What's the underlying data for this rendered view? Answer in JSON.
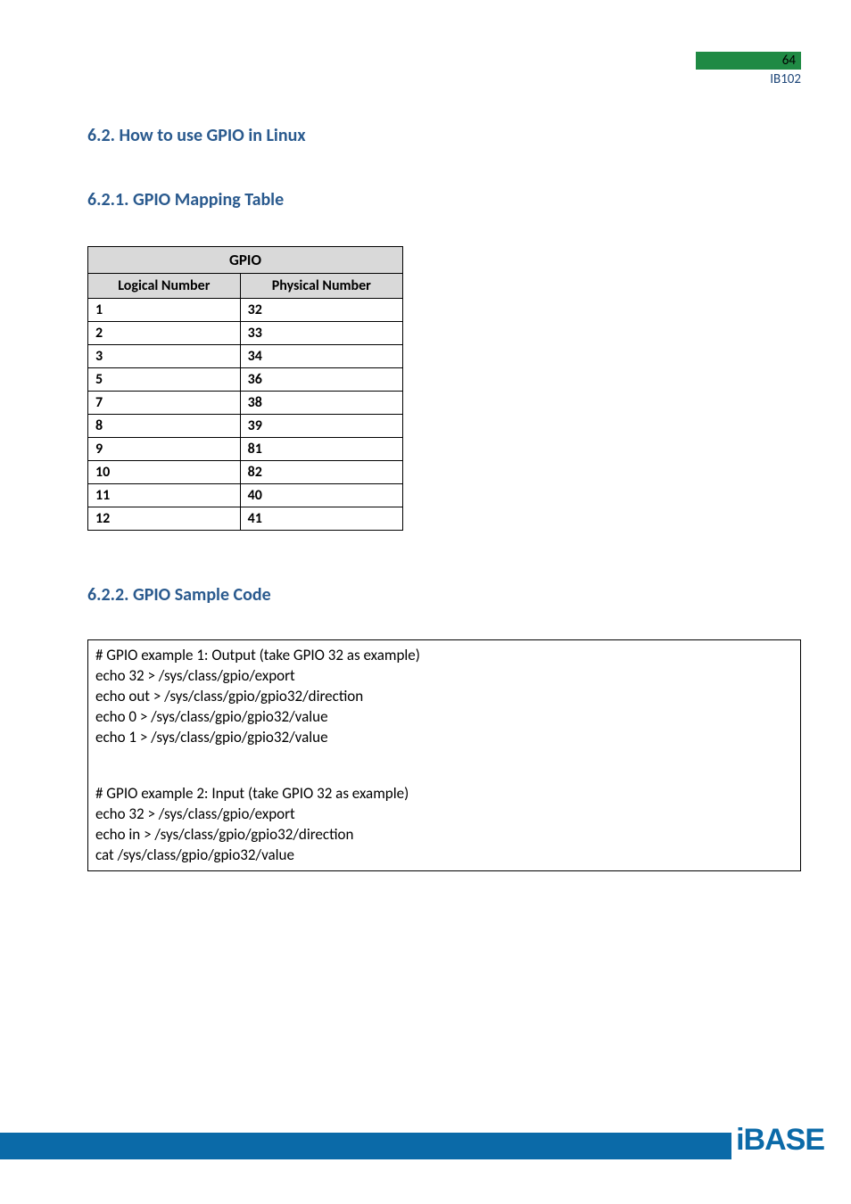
{
  "header": {
    "page_number": "64",
    "doc_id": "IB102"
  },
  "headings": {
    "h62": "6.2.  How to use GPIO in Linux",
    "h621": "6.2.1. GPIO Mapping Table",
    "h622": "6.2.2. GPIO Sample Code"
  },
  "table": {
    "title": "GPIO",
    "col1": "Logical Number",
    "col2": "Physical Number",
    "rows": [
      {
        "logical": "1",
        "physical": "32"
      },
      {
        "logical": "2",
        "physical": "33"
      },
      {
        "logical": "3",
        "physical": "34"
      },
      {
        "logical": "5",
        "physical": "36"
      },
      {
        "logical": "7",
        "physical": "38"
      },
      {
        "logical": "8",
        "physical": "39"
      },
      {
        "logical": "9",
        "physical": "81"
      },
      {
        "logical": "10",
        "physical": "82"
      },
      {
        "logical": "11",
        "physical": "40"
      },
      {
        "logical": "12",
        "physical": "41"
      }
    ]
  },
  "code": {
    "ex1": [
      "# GPIO example 1: Output (take GPIO 32 as example)",
      "echo 32 > /sys/class/gpio/export",
      "echo out > /sys/class/gpio/gpio32/direction",
      "echo 0 > /sys/class/gpio/gpio32/value",
      "echo 1 > /sys/class/gpio/gpio32/value"
    ],
    "ex2": [
      "# GPIO example 2: Input (take GPIO 32 as example)",
      "echo 32 > /sys/class/gpio/export",
      "echo in > /sys/class/gpio/gpio32/direction",
      "cat /sys/class/gpio/gpio32/value"
    ]
  },
  "footer": {
    "brand": "iBASE"
  }
}
